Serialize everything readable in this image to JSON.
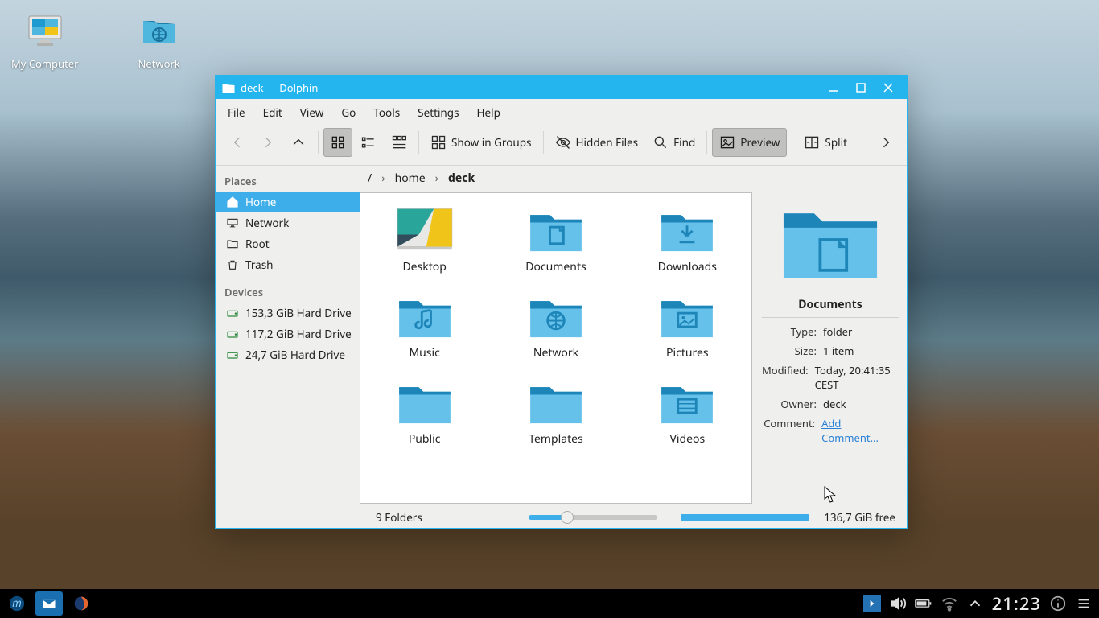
{
  "desktop": {
    "icons": [
      {
        "name": "my-computer",
        "label": "My Computer"
      },
      {
        "name": "network",
        "label": "Network"
      }
    ]
  },
  "window": {
    "title": "deck — Dolphin",
    "menubar": [
      "File",
      "Edit",
      "View",
      "Go",
      "Tools",
      "Settings",
      "Help"
    ],
    "toolbar": {
      "show_in_groups": "Show in Groups",
      "hidden_files": "Hidden Files",
      "find": "Find",
      "preview": "Preview",
      "split": "Split"
    },
    "breadcrumb": {
      "root": "/",
      "home": "home",
      "current": "deck"
    },
    "sidebar": {
      "places_title": "Places",
      "devices_title": "Devices",
      "places": [
        {
          "label": "Home",
          "selected": true
        },
        {
          "label": "Network",
          "selected": false
        },
        {
          "label": "Root",
          "selected": false
        },
        {
          "label": "Trash",
          "selected": false
        }
      ],
      "devices": [
        {
          "label": "153,3 GiB Hard Drive"
        },
        {
          "label": "117,2 GiB Hard Drive"
        },
        {
          "label": "24,7 GiB Hard Drive"
        }
      ]
    },
    "files": [
      {
        "label": "Desktop",
        "variant": "desktop"
      },
      {
        "label": "Documents",
        "variant": "documents"
      },
      {
        "label": "Downloads",
        "variant": "downloads"
      },
      {
        "label": "Music",
        "variant": "music"
      },
      {
        "label": "Network",
        "variant": "network"
      },
      {
        "label": "Pictures",
        "variant": "pictures"
      },
      {
        "label": "Public",
        "variant": "public"
      },
      {
        "label": "Templates",
        "variant": "templates"
      },
      {
        "label": "Videos",
        "variant": "videos"
      }
    ],
    "info": {
      "title": "Documents",
      "kv": {
        "type_k": "Type:",
        "type_v": "folder",
        "size_k": "Size:",
        "size_v": "1 item",
        "modified_k": "Modified:",
        "modified_v": "Today, 20:41:35 CEST",
        "owner_k": "Owner:",
        "owner_v": "deck",
        "comment_k": "Comment:",
        "comment_v": "Add Comment..."
      }
    },
    "status": {
      "left": "9 Folders",
      "right": "136,7 GiB free"
    }
  },
  "taskbar": {
    "clock": "21:23"
  }
}
